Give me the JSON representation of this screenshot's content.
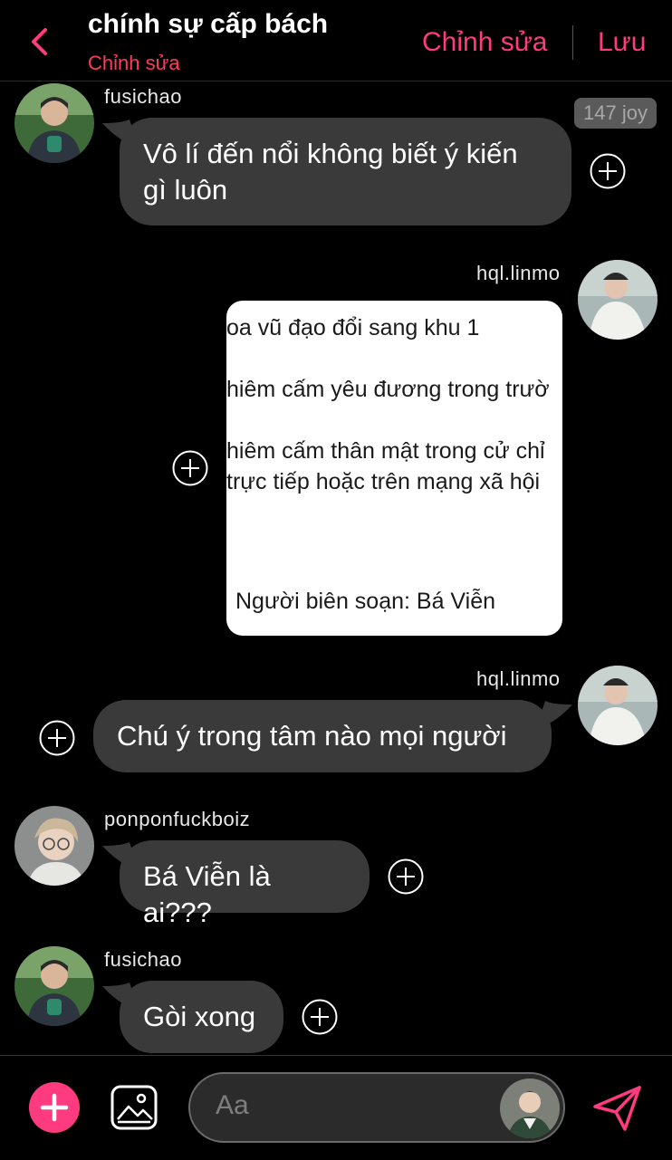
{
  "header": {
    "title": "chính sự cấp bách",
    "subtitle": "Chỉnh sửa",
    "edit_label": "Chỉnh sửa",
    "save_label": "Lưu",
    "accent": "#ff3b7f"
  },
  "messages": [
    {
      "user": "fusichao",
      "text": "Vô lí đến nổi không biết ý kiến gì luôn",
      "line1": "Vô lí đến nổi không biết ý kiến",
      "line2": "gì luôn",
      "badge": "147 joy",
      "side": "left"
    },
    {
      "user": "hql.linmo",
      "type": "image",
      "side": "right",
      "image_lines": [
        "oa vũ đạo đổi sang khu 1",
        "hiêm cấm yêu đương trong trườ",
        "hiêm cấm thân mật trong cử chỉ",
        "trực tiếp hoặc trên mạng xã hội",
        "Người biên soạn: Bá Viễn"
      ]
    },
    {
      "user": "hql.linmo",
      "text": "Chú ý trong tâm nào mọi người",
      "side": "right"
    },
    {
      "user": "ponponfuckboiz",
      "text": "Bá Viễn là ai???",
      "side": "left"
    },
    {
      "user": "fusichao",
      "text": "Gòi xong",
      "side": "left"
    }
  ],
  "composer": {
    "placeholder": "Aa",
    "icons": [
      "plus-icon",
      "image-icon",
      "send-icon"
    ]
  },
  "colors": {
    "bubble": "#3a3a3a",
    "background": "#000000",
    "accent": "#ff3b7f",
    "subtitle": "#ff3b5c"
  }
}
